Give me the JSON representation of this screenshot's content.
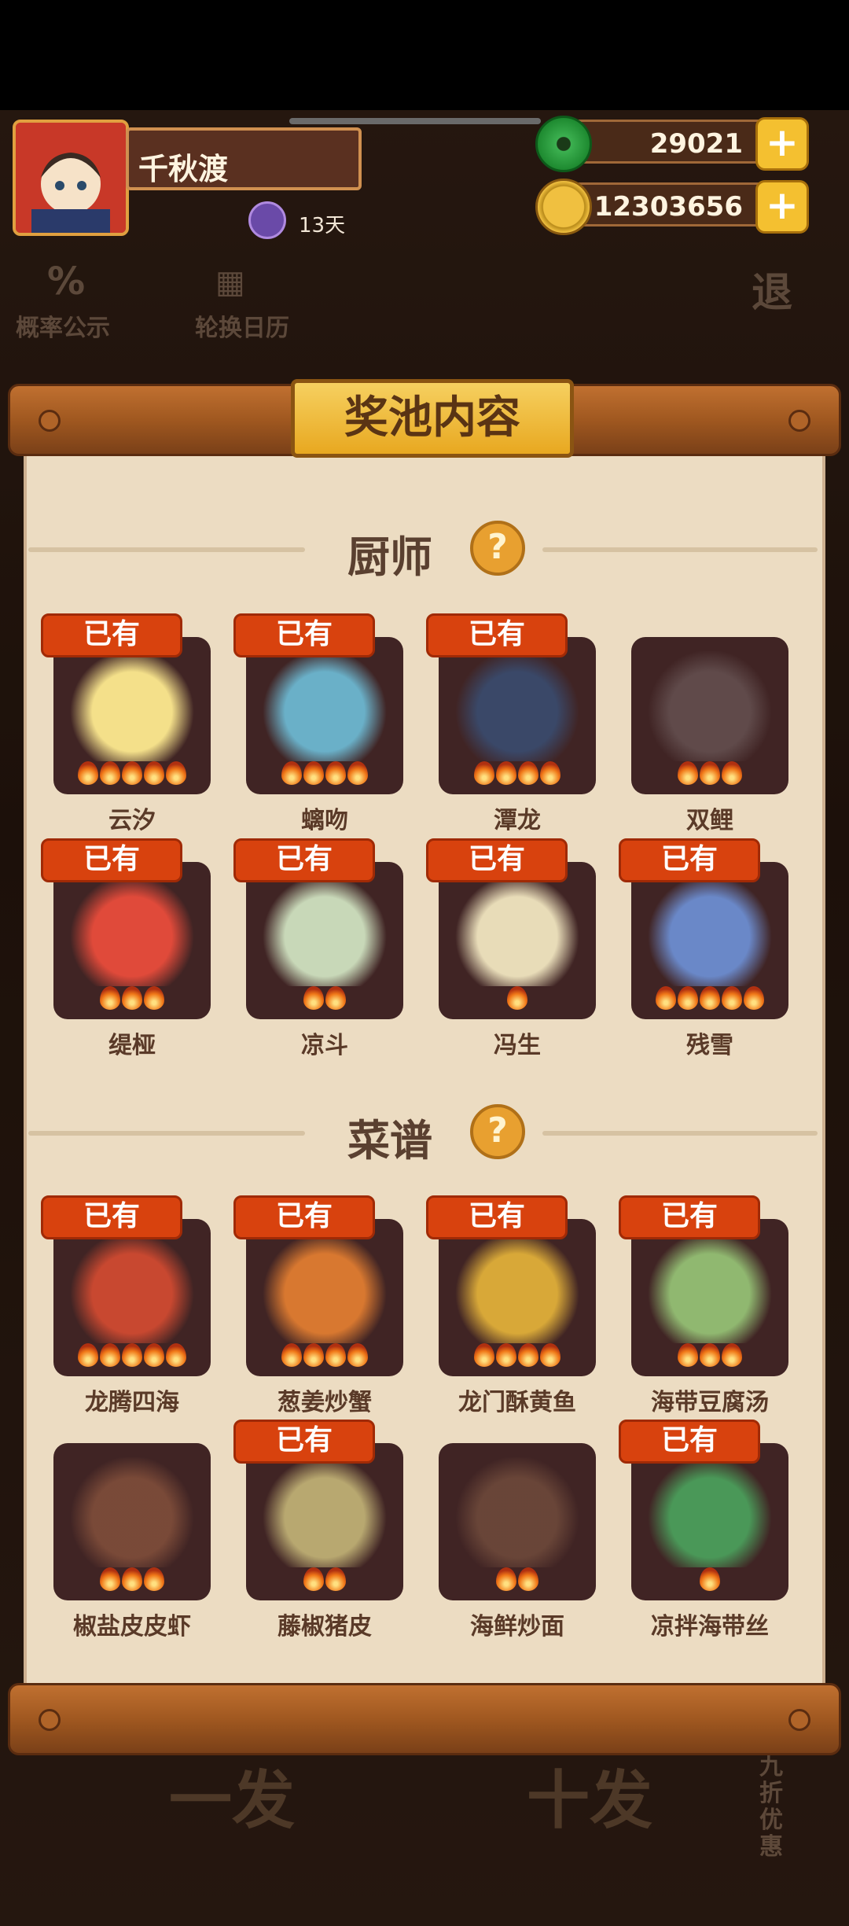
{
  "hud": {
    "player_name": "千秋渡",
    "days": "13天",
    "jade": "29021",
    "coins": "12303656",
    "plus": "+"
  },
  "background": {
    "probability": "概率公示",
    "rotation_calendar": "轮换日历",
    "exit": "退",
    "single_draw": "一发",
    "ten_draw": "十发",
    "discount": "九折优惠"
  },
  "panel": {
    "title": "奖池内容",
    "help": "?",
    "chef_section": "厨师",
    "recipe_section": "菜谱",
    "owned": "已有",
    "chefs": [
      {
        "name": "云汐",
        "stars": 5,
        "owned": true,
        "color": "#f4e08a"
      },
      {
        "name": "螭吻",
        "stars": 4,
        "owned": true,
        "color": "#6ab0c8"
      },
      {
        "name": "潭龙",
        "stars": 4,
        "owned": true,
        "color": "#3a4868"
      },
      {
        "name": "双鲤",
        "stars": 3,
        "owned": false,
        "color": "#7a6a6a"
      },
      {
        "name": "缇桠",
        "stars": 3,
        "owned": true,
        "color": "#e04a3a"
      },
      {
        "name": "凉斗",
        "stars": 2,
        "owned": true,
        "color": "#c8d8b8"
      },
      {
        "name": "冯生",
        "stars": 1,
        "owned": true,
        "color": "#e8dcb8"
      },
      {
        "name": "残雪",
        "stars": 5,
        "owned": true,
        "color": "#6a88c8"
      }
    ],
    "recipes": [
      {
        "name": "龙腾四海",
        "stars": 5,
        "owned": true,
        "color": "#c84830"
      },
      {
        "name": "葱姜炒蟹",
        "stars": 4,
        "owned": true,
        "color": "#d87830"
      },
      {
        "name": "龙门酥黄鱼",
        "stars": 4,
        "owned": true,
        "color": "#d8a838"
      },
      {
        "name": "海带豆腐汤",
        "stars": 3,
        "owned": true,
        "color": "#90b870"
      },
      {
        "name": "椒盐皮皮虾",
        "stars": 3,
        "owned": false,
        "color": "#a86848"
      },
      {
        "name": "藤椒猪皮",
        "stars": 2,
        "owned": true,
        "color": "#b8a870"
      },
      {
        "name": "海鲜炒面",
        "stars": 2,
        "owned": false,
        "color": "#8a6048"
      },
      {
        "name": "凉拌海带丝",
        "stars": 1,
        "owned": true,
        "color": "#4a9858"
      }
    ]
  }
}
